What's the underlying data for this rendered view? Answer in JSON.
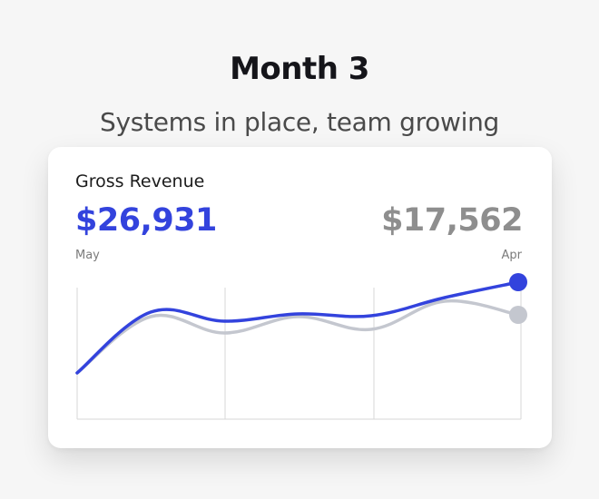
{
  "header": {
    "title": "Month 3",
    "subtitle": "Systems in place, team growing"
  },
  "card": {
    "title": "Gross Revenue",
    "current_value": "$26,931",
    "previous_value": "$17,562",
    "start_label": "May",
    "end_label": "Apr"
  },
  "colors": {
    "current": "#3343dd",
    "previous": "#c4c7cf",
    "gridline": "#d7d7d7"
  },
  "chart_data": {
    "type": "line",
    "x_start_label": "May",
    "x_end_label": "Apr",
    "series": [
      {
        "key": "current",
        "values": [
          0.0,
          0.67,
          0.57,
          0.65,
          0.63,
          0.83,
          1.0
        ]
      },
      {
        "key": "previous",
        "values": [
          0.0,
          0.62,
          0.44,
          0.62,
          0.48,
          0.79,
          0.64
        ]
      }
    ],
    "grid": true
  }
}
